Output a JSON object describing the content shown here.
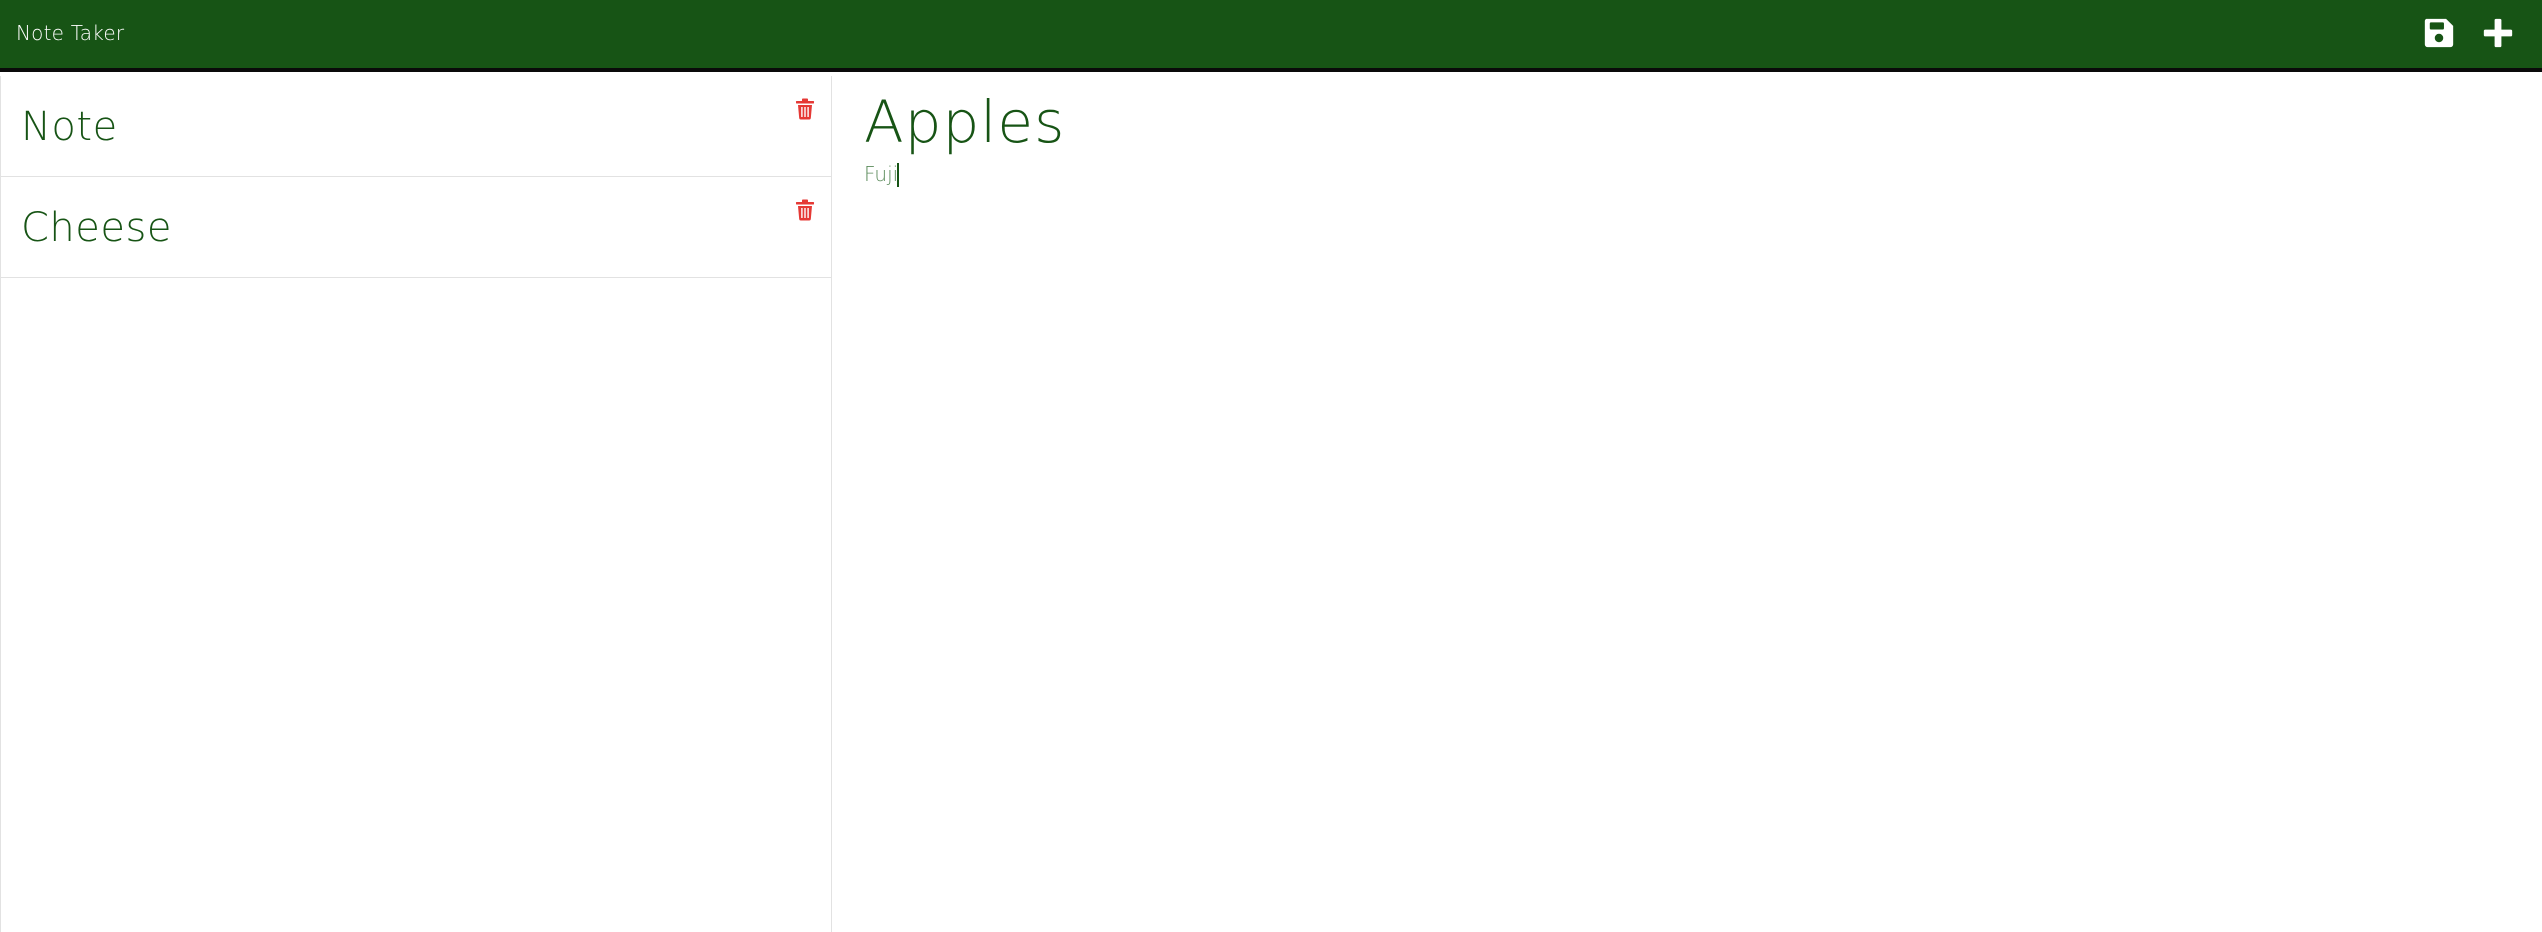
{
  "header": {
    "brand": "Note Taker",
    "background_color": "#175415",
    "save_icon": "floppy-disk-icon",
    "add_icon": "plus-icon"
  },
  "sidebar": {
    "notes": [
      {
        "title": "Note",
        "delete_icon": "trash-icon",
        "icon_color": "#e53935"
      },
      {
        "title": "Cheese",
        "delete_icon": "trash-icon",
        "icon_color": "#e53935"
      }
    ]
  },
  "editor": {
    "title_value": "Apples",
    "body_value": "Fuji",
    "text_color": "#175415"
  }
}
